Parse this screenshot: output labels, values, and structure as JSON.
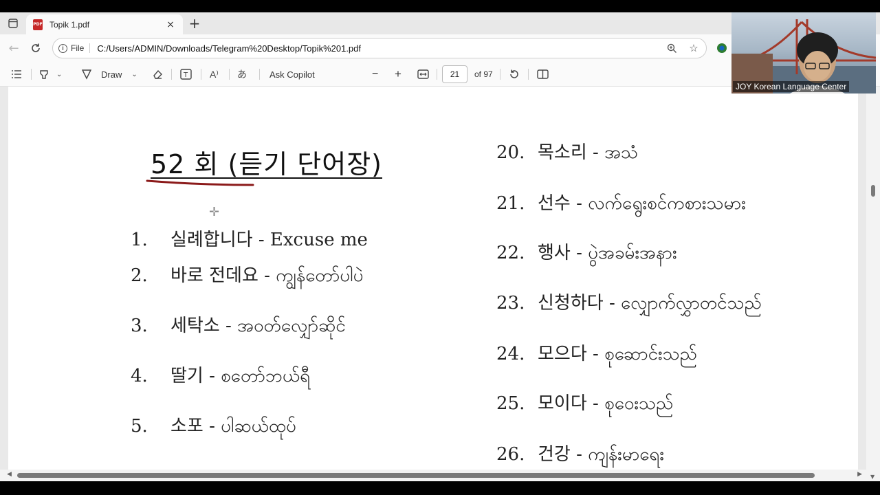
{
  "browser": {
    "tab_title": "Topik 1.pdf",
    "tab_close": "×",
    "new_tab": "+",
    "file_chip": "File",
    "url": "C:/Users/ADMIN/Downloads/Telegram%20Desktop/Topik%201.pdf"
  },
  "pdf_toolbar": {
    "draw_label": "Draw",
    "copilot_label": "Ask Copilot",
    "zoom_out": "−",
    "zoom_in": "+",
    "page_current": "21",
    "page_total": "of 97"
  },
  "document": {
    "heading": "52 회 (듣기 단어장)",
    "left_items": [
      {
        "num": "1.",
        "text": "실례합니다 - Excuse me"
      },
      {
        "num": "2.",
        "text": "바로 전데요 - ကျွန်တော်ပါပဲ"
      },
      {
        "num": "3.",
        "text": "세탁소 - အဝတ်လျှော်ဆိုင်"
      },
      {
        "num": "4.",
        "text": "딸기 - စတော်ဘယ်ရီ"
      },
      {
        "num": "5.",
        "text": "소포 - ပါဆယ်ထုပ်"
      }
    ],
    "right_items": [
      {
        "num": "20.",
        "text": "목소리 - အသံ"
      },
      {
        "num": "21.",
        "text": "선수 - လက်ရွေးစင်ကစားသမား"
      },
      {
        "num": "22.",
        "text": "행사 - ပွဲအခမ်းအနား"
      },
      {
        "num": "23.",
        "text": "신청하다 - လျှောက်လွှာတင်သည်"
      },
      {
        "num": "24.",
        "text": "모으다 - စုဆောင်းသည်"
      },
      {
        "num": "25.",
        "text": "모이다 - စုဝေးသည်"
      },
      {
        "num": "26.",
        "text": "건강 - ကျန်းမာရေး"
      }
    ]
  },
  "webcam": {
    "label": "JOY Korean Language Center"
  },
  "colors": {
    "pdf_red": "#c62828",
    "underline_red": "#8b1a1a"
  }
}
